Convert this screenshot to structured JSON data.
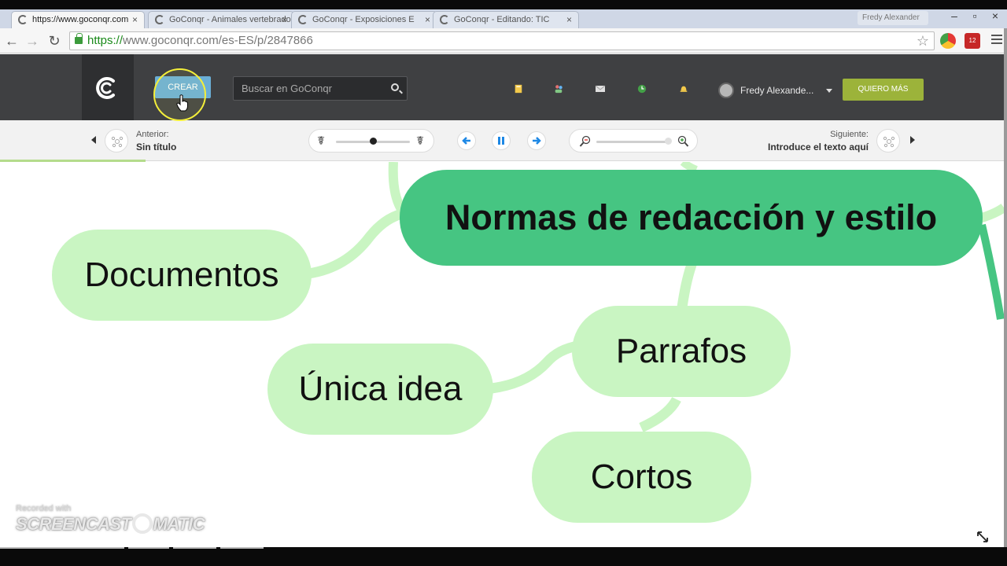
{
  "browser": {
    "tabs": [
      {
        "title": "https://www.goconqr.com",
        "active": true
      },
      {
        "title": "GoConqr - Animales vertebrados",
        "active": false
      },
      {
        "title": "GoConqr - Exposiciones E",
        "active": false
      },
      {
        "title": "GoConqr - Editando: TIC",
        "active": false
      }
    ],
    "tab_close": "×",
    "tab_user": "Fredy Alexander",
    "url_scheme": "https://",
    "url_rest": "www.goconqr.com/es-ES/p/2847866",
    "ext_badge": "12"
  },
  "header": {
    "create_label": "CREAR",
    "search_placeholder": "Buscar en GoConqr",
    "user_name": "Fredy Alexande...",
    "cta_label": "QUIERO MÁS"
  },
  "navigation": {
    "previous_caption": "Anterior:",
    "previous_title": "Sin título",
    "next_caption": "Siguiente:",
    "next_title": "Introduce el texto aquí",
    "speed_slider_value": 0.5,
    "zoom_slider_value": 0.97,
    "slide_progress": 0.145
  },
  "mindmap": {
    "root": "Normas de redacción y estilo",
    "nodes": [
      "Documentos",
      "Parrafos",
      "Única idea",
      "Cortos"
    ]
  },
  "watermark": {
    "line1": "Recorded with",
    "line2": "SCREENCAST",
    "line3": "MATIC"
  },
  "colors": {
    "header_bg": "#3f4042",
    "create_button": "#6aaed6",
    "cta_button": "#9cb33a",
    "root_node": "#46c582",
    "child_node": "#c9f5c2",
    "connector": "#c9f5c2"
  }
}
